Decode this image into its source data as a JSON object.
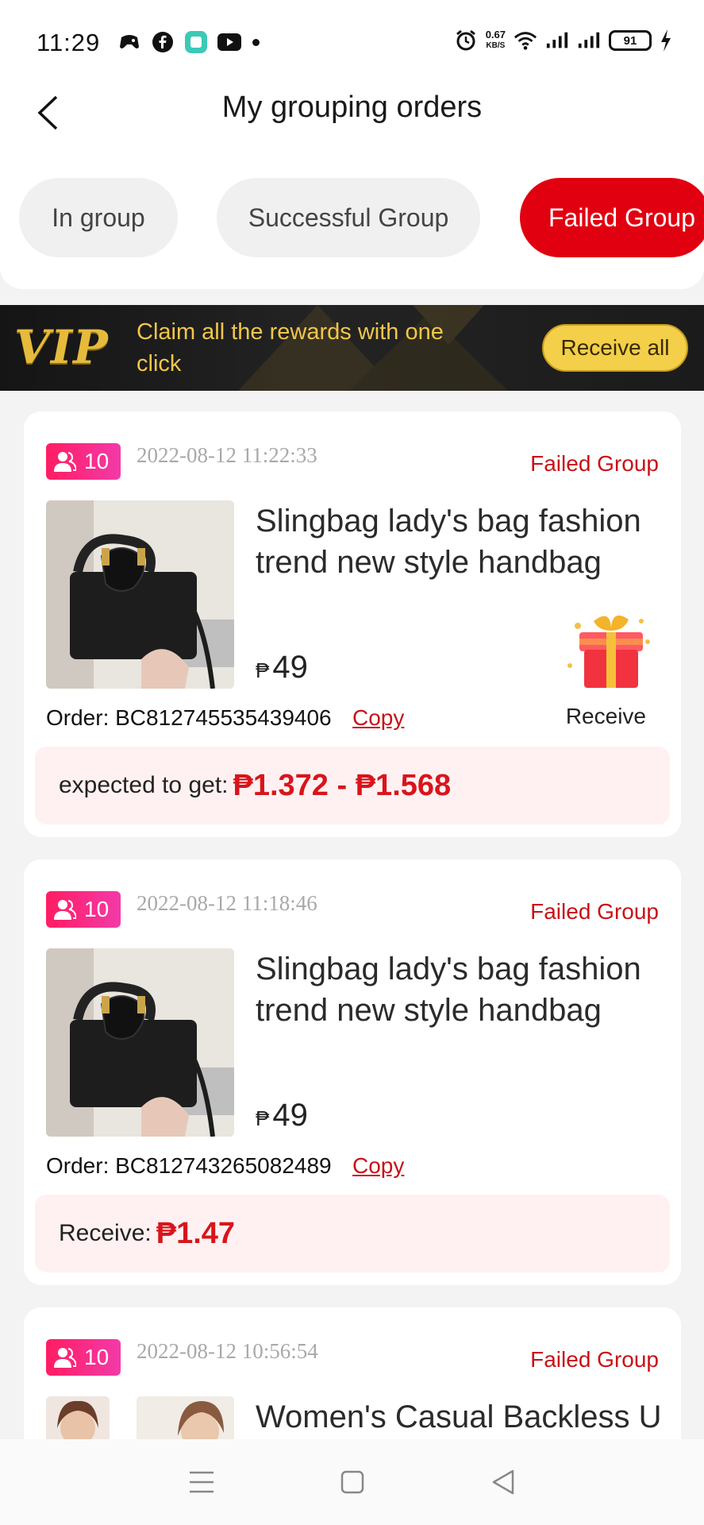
{
  "status_bar": {
    "time": "11:29",
    "net_speed_value": "0.67",
    "net_speed_unit": "KB/S",
    "battery": "91",
    "icons": [
      "game-icon",
      "facebook-icon",
      "app-icon",
      "youtube-icon",
      "dot-icon",
      "alarm-icon",
      "wifi-icon",
      "signal-icon",
      "signal-icon",
      "battery-icon",
      "charging-icon"
    ]
  },
  "header": {
    "title": "My grouping orders",
    "tabs": [
      {
        "label": "In group",
        "active": false
      },
      {
        "label": "Successful Group",
        "active": false
      },
      {
        "label": "Failed Group",
        "active": true
      }
    ]
  },
  "vip": {
    "logo": "VIP",
    "text": "Claim all the rewards with one click",
    "button": "Receive all"
  },
  "orders": [
    {
      "member_count": "10",
      "time": "2022-08-12 11:22:33",
      "status": "Failed Group",
      "title": "Slingbag lady's bag fashion trend new style handbag",
      "currency": "₱",
      "price": "49",
      "order_label": "Order: BC812745535439406",
      "copy": "Copy",
      "receive": "Receive",
      "reward_label": "expected to get:",
      "reward_value": "₱1.372 - ₱1.568"
    },
    {
      "member_count": "10",
      "time": "2022-08-12 11:18:46",
      "status": "Failed Group",
      "title": "Slingbag lady's bag fashion trend new style handbag",
      "currency": "₱",
      "price": "49",
      "order_label": "Order: BC812743265082489",
      "copy": "Copy",
      "reward_label": "Receive:",
      "reward_value": "₱1.47"
    },
    {
      "member_count": "10",
      "time": "2022-08-12 10:56:54",
      "status": "Failed Group",
      "title": "Women's Casual Backless U"
    }
  ],
  "colors": {
    "accent": "#e10010",
    "status_red": "#c81217",
    "vip_gold": "#f1c64a",
    "badge_pink": "#ff1d62"
  }
}
